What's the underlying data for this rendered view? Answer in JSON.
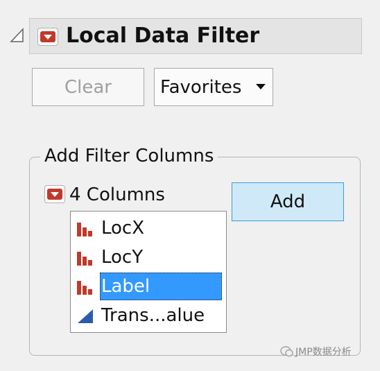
{
  "filter": {
    "title": "Local Data Filter",
    "title_menu_icon": "red-triangle-menu-icon",
    "outline_icon": "disclosure-triangle-icon"
  },
  "buttons": {
    "clear_label": "Clear",
    "clear_enabled": false,
    "favorites_label": "Favorites",
    "favorites_icon": "dropdown-arrow-icon"
  },
  "add_filter": {
    "group_label": "Add Filter Columns",
    "columns_label": "4 Columns",
    "add_label": "Add",
    "columns": [
      {
        "label": "LocX",
        "icon": "nominal-bar-icon",
        "selected": false
      },
      {
        "label": "LocY",
        "icon": "nominal-bar-icon",
        "selected": false
      },
      {
        "label": "Label",
        "icon": "nominal-bar-icon",
        "selected": true
      },
      {
        "label": "Trans...alue",
        "icon": "continuous-triangle-icon",
        "selected": false
      }
    ]
  },
  "colors": {
    "red_icon": "#c0392b",
    "blue_icon": "#2a5caa",
    "selection": "#3399ff",
    "add_button_bg": "#cfe9f8"
  },
  "watermark": "JMP数据分析"
}
